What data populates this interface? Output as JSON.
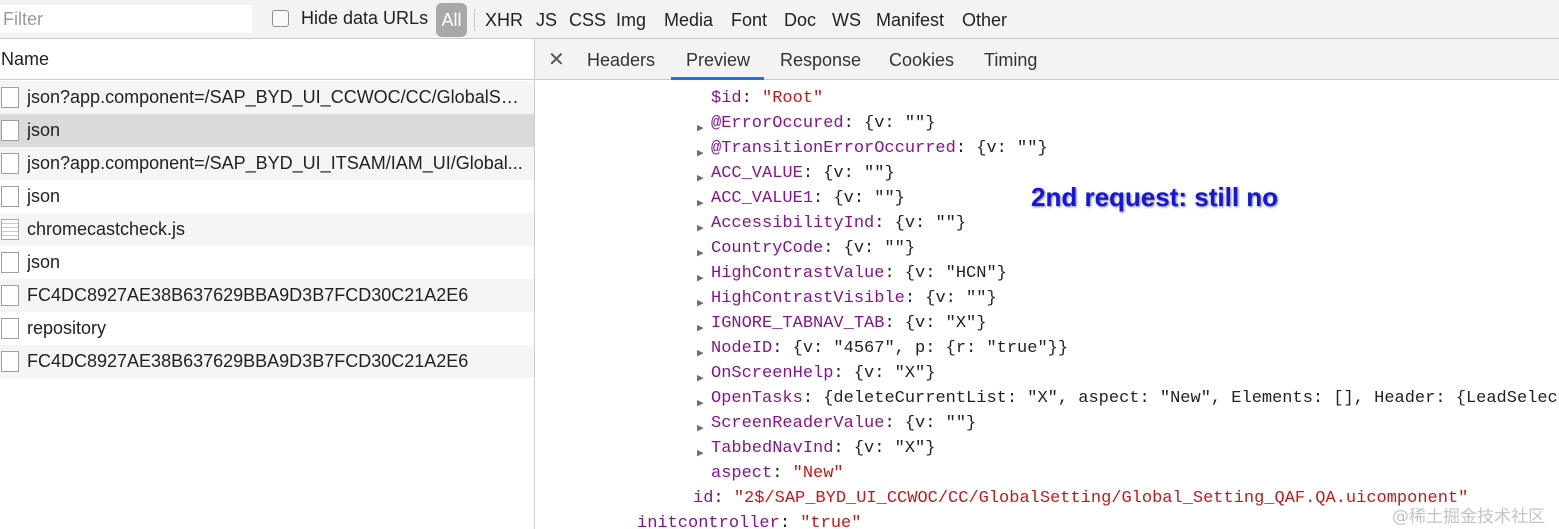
{
  "toolbar": {
    "filter_placeholder": "Filter",
    "hide_data_urls_label": "Hide data URLs",
    "type_filters": [
      "All",
      "XHR",
      "JS",
      "CSS",
      "Img",
      "Media",
      "Font",
      "Doc",
      "WS",
      "Manifest",
      "Other"
    ],
    "selected_type": "All"
  },
  "request_list": {
    "header": "Name",
    "rows": [
      {
        "name": "json?app.component=/SAP_BYD_UI_CCWOC/CC/GlobalSet...",
        "icon": "document-icon"
      },
      {
        "name": "json",
        "icon": "document-icon",
        "selected": true
      },
      {
        "name": "json?app.component=/SAP_BYD_UI_ITSAM/IAM_UI/Global...",
        "icon": "document-icon"
      },
      {
        "name": "json",
        "icon": "document-icon"
      },
      {
        "name": "chromecastcheck.js",
        "icon": "script-icon"
      },
      {
        "name": "json",
        "icon": "document-icon"
      },
      {
        "name": "FC4DC8927AE38B637629BBA9D3B7FCD30C21A2E6",
        "icon": "document-icon"
      },
      {
        "name": "repository",
        "icon": "document-icon"
      },
      {
        "name": "FC4DC8927AE38B637629BBA9D3B7FCD30C21A2E6",
        "icon": "document-icon"
      }
    ]
  },
  "detail": {
    "close_icon": "close-icon",
    "tabs": [
      "Headers",
      "Preview",
      "Response",
      "Cookies",
      "Timing"
    ],
    "active_tab": "Preview",
    "preview_lines": [
      {
        "key": "$id",
        "value": "\"Root\"",
        "expandable": false
      },
      {
        "key": "@ErrorOccured",
        "value": "{v: \"\"}",
        "expandable": true
      },
      {
        "key": "@TransitionErrorOccurred",
        "value": "{v: \"\"}",
        "expandable": true
      },
      {
        "key": "ACC_VALUE",
        "value": "{v: \"\"}",
        "expandable": true
      },
      {
        "key": "ACC_VALUE1",
        "value": "{v: \"\"}",
        "expandable": true
      },
      {
        "key": "AccessibilityInd",
        "value": "{v: \"\"}",
        "expandable": true
      },
      {
        "key": "CountryCode",
        "value": "{v: \"\"}",
        "expandable": true
      },
      {
        "key": "HighContrastValue",
        "value": "{v: \"HCN\"}",
        "expandable": true
      },
      {
        "key": "HighContrastVisible",
        "value": "{v: \"\"}",
        "expandable": true
      },
      {
        "key": "IGNORE_TABNAV_TAB",
        "value": "{v: \"X\"}",
        "expandable": true
      },
      {
        "key": "NodeID",
        "value": "{v: \"4567\", p: {r: \"true\"}}",
        "expandable": true
      },
      {
        "key": "OnScreenHelp",
        "value": "{v: \"X\"}",
        "expandable": true
      },
      {
        "key": "OpenTasks",
        "value": "{deleteCurrentList: \"X\", aspect: \"New\", Elements: [], Header: {LeadSelec",
        "expandable": true
      },
      {
        "key": "ScreenReaderValue",
        "value": "{v: \"\"}",
        "expandable": true
      },
      {
        "key": "TabbedNavInd",
        "value": "{v: \"X\"}",
        "expandable": true
      },
      {
        "key": "aspect",
        "value": "\"New\"",
        "expandable": false
      },
      {
        "key": "id",
        "value": "\"2$/SAP_BYD_UI_CCWOC/CC/GlobalSetting/Global_Setting_QAF.QA.uicomponent\"",
        "expandable": false
      },
      {
        "key": "initcontroller",
        "value": "\"true\"",
        "expandable": false
      }
    ]
  },
  "annotation": "2nd request: still no",
  "watermark": "@稀土掘金技术社区"
}
